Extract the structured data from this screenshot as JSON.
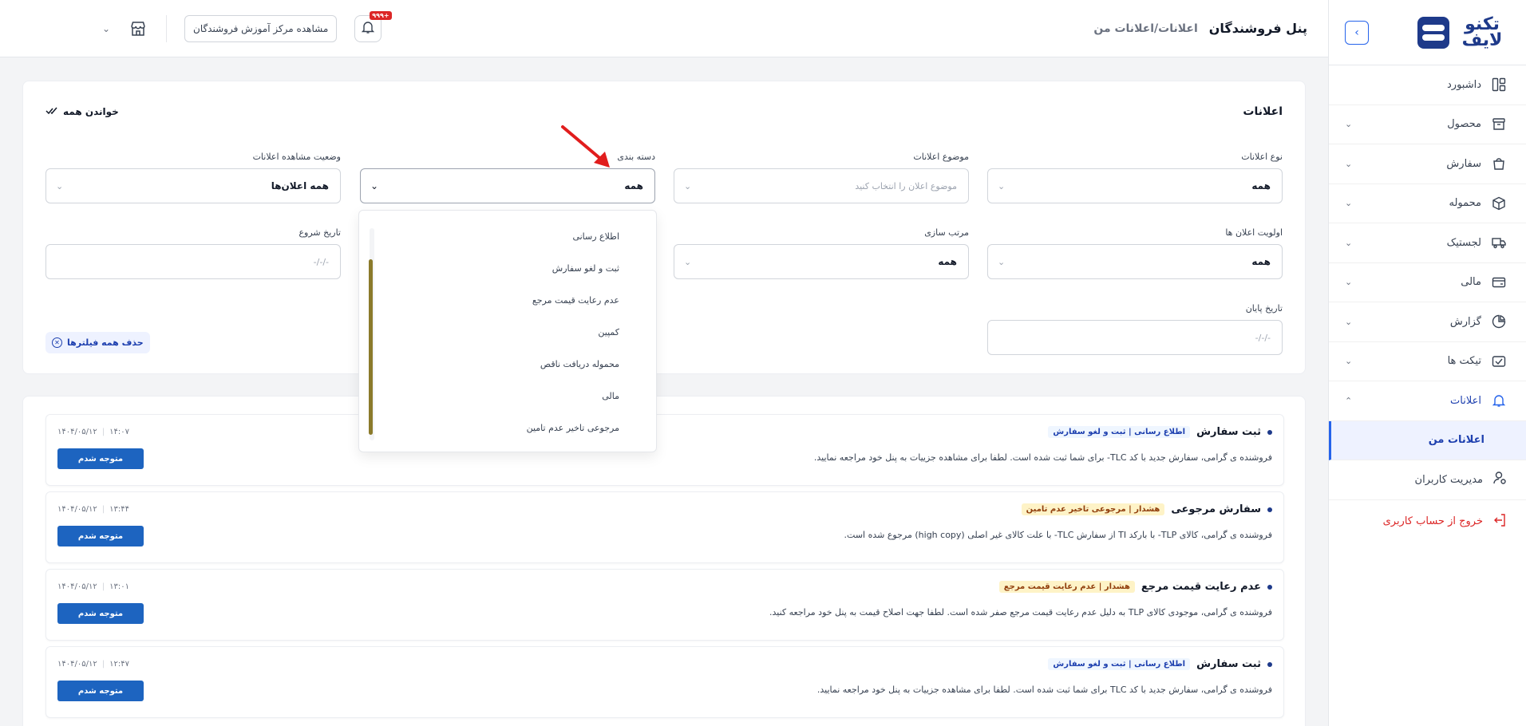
{
  "sidebar": {
    "brand": "تکنو لایف",
    "items": [
      {
        "label": "داشبورد",
        "icon": "dashboard-icon",
        "has_children": false
      },
      {
        "label": "محصول",
        "icon": "product-box-icon",
        "has_children": true
      },
      {
        "label": "سفارش",
        "icon": "shopping-bag-icon",
        "has_children": true
      },
      {
        "label": "محموله",
        "icon": "package-icon",
        "has_children": true
      },
      {
        "label": "لجستیک",
        "icon": "truck-icon",
        "has_children": true
      },
      {
        "label": "مالی",
        "icon": "wallet-icon",
        "has_children": true
      },
      {
        "label": "گزارش",
        "icon": "report-chart-icon",
        "has_children": true
      },
      {
        "label": "تیکت ها",
        "icon": "ticket-icon",
        "has_children": true
      },
      {
        "label": "اعلانات",
        "icon": "bell-icon",
        "has_children": true,
        "expanded": true
      }
    ],
    "subitems": [
      {
        "label": "اعلانات من",
        "active": true
      },
      {
        "label": "مدیریت کاربران",
        "icon": "user-settings-icon"
      }
    ],
    "logout": "خروج از حساب کاربری"
  },
  "header": {
    "title": "پنل فروشندگان",
    "breadcrumb": "اعلانات/اعلانات من",
    "notif_badge": "+۹۹۹",
    "learn_center": "مشاهده مرکز آموزش فروشندگان"
  },
  "filters": {
    "title": "اعلانات",
    "read_all": "خواندن همه",
    "notif_type": {
      "label": "نوع اعلانات",
      "value": "همه"
    },
    "notif_subject": {
      "label": "موضوع اعلانات",
      "placeholder": "موضوع اعلان را انتخاب کنید"
    },
    "category": {
      "label": "دسته بندی",
      "value": "همه"
    },
    "view_status": {
      "label": "وضعیت مشاهده اعلانات",
      "value": "همه اعلان‌ها"
    },
    "priority": {
      "label": "اولویت اعلان ها",
      "value": "همه"
    },
    "sort": {
      "label": "مرتب سازی",
      "value": "همه"
    },
    "start_date": {
      "label": "تاریخ شروع",
      "placeholder": "-/-/-"
    },
    "end_date": {
      "label": "تاریخ پایان",
      "placeholder": "-/-/-"
    },
    "clear_all": "حذف همه فیلترها"
  },
  "category_options": [
    "اطلاع رسانی",
    "ثبت و لغو سفارش",
    "عدم رعایت قیمت مرجع",
    "کمپین",
    "محموله دریافت ناقص",
    "مالی",
    "مرجوعی تاخیر عدم تامین"
  ],
  "notifications": [
    {
      "title": "ثبت سفارش",
      "tag": "اطلاع رسانی | ثبت و لغو سفارش",
      "tag_type": "info",
      "date": "۱۴۰۴/۰۵/۱۲",
      "time": "۱۴:۰۷",
      "body": "فروشنده ی گرامی، سفارش جدید با کد TLC- برای شما ثبت شده است. لطفا برای مشاهده جزییات به پنل خود مراجعه نمایید.",
      "button": "متوجه شدم"
    },
    {
      "title": "سفارش مرجوعی",
      "tag": "هشدار | مرجوعی تاخیر عدم تامین",
      "tag_type": "warn",
      "date": "۱۴۰۴/۰۵/۱۲",
      "time": "۱۳:۴۴",
      "body": "فروشنده ی گرامی، کالای TLP- با بارکد TI از سفارش TLC- با علت کالای غیر اصلی (high copy) مرجوع شده است.",
      "button": "متوجه شدم"
    },
    {
      "title": "عدم رعایت قیمت مرجع",
      "tag": "هشدار | عدم رعایت قیمت مرجع",
      "tag_type": "warn",
      "date": "۱۴۰۴/۰۵/۱۲",
      "time": "۱۳:۰۱",
      "body": "فروشنده ی گرامی، موجودی کالای TLP به دلیل عدم رعایت قیمت مرجع صفر شده است. لطفا جهت اصلاح قیمت به پنل خود مراجعه کنید.",
      "button": "متوجه شدم"
    },
    {
      "title": "ثبت سفارش",
      "tag": "اطلاع رسانی | ثبت و لغو سفارش",
      "tag_type": "info",
      "date": "۱۴۰۴/۰۵/۱۲",
      "time": "۱۲:۴۷",
      "body": "فروشنده ی گرامی، سفارش جدید با کد TLC برای شما ثبت شده است. لطفا برای مشاهده جزییات به پنل خود مراجعه نمایید.",
      "button": "متوجه شدم"
    }
  ],
  "colors": {
    "primary": "#1d64c0",
    "brand": "#1e3a8a",
    "danger": "#dc2626",
    "annotation_arrow": "#e11d1d"
  }
}
